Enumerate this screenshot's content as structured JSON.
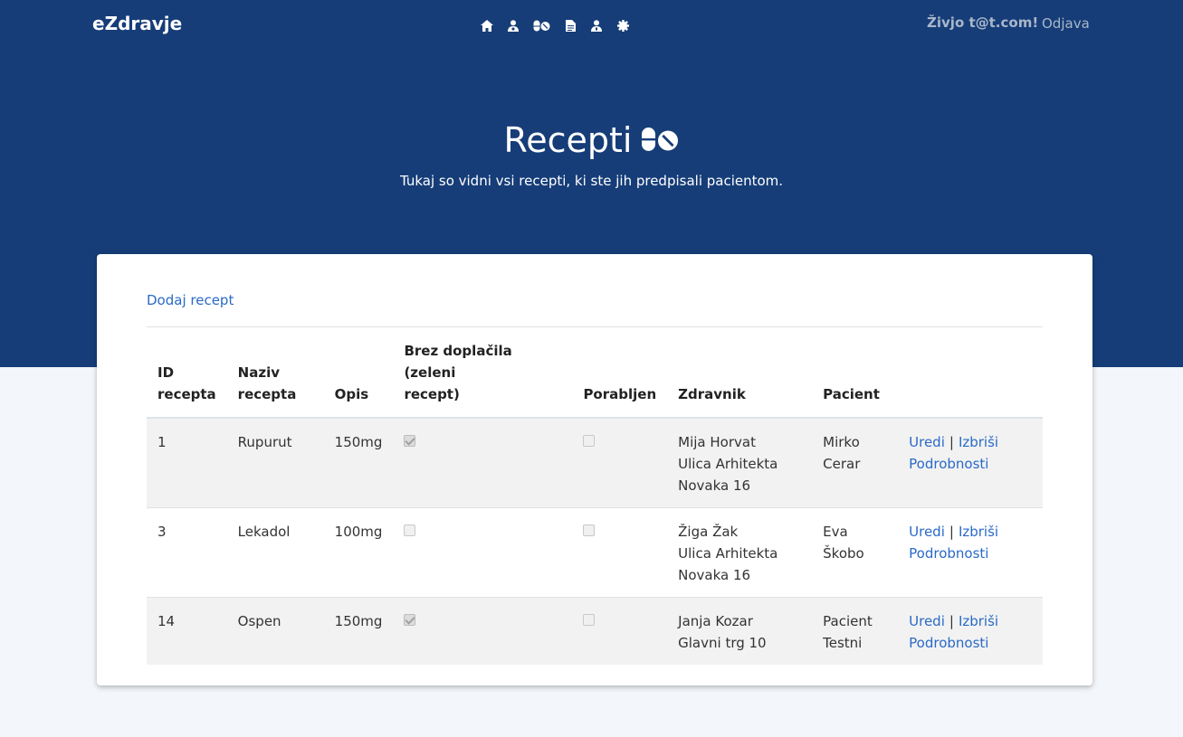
{
  "nav": {
    "brand": "eZdravje",
    "icons": [
      "home-icon",
      "user-doctor-icon",
      "pills-icon",
      "document-icon",
      "user-icon",
      "cog-icon"
    ],
    "greeting": "Živjo t@t.com!",
    "logout": "Odjava"
  },
  "hero": {
    "title": "Recepti",
    "title_icon": "pills-icon",
    "subtitle": "Tukaj so vidni vsi recepti, ki ste jih predpisali pacientom."
  },
  "colors": {
    "hero_bg": "#163d78",
    "link": "#2a6ac7",
    "page_bg": "#f3f6fa"
  },
  "table": {
    "add_link": "Dodaj recept",
    "headers": {
      "id_line1": "ID",
      "id_line2": "recepta",
      "name_line1": "Naziv",
      "name_line2": "recepta",
      "desc": "Opis",
      "free_line1": "Brez doplačila (zeleni",
      "free_line2": "recept)",
      "used": "Porabljen",
      "doctor": "Zdravnik",
      "patient": "Pacient"
    },
    "rows": [
      {
        "id": "1",
        "name": "Rupurut",
        "desc": "150mg",
        "free": true,
        "used": false,
        "doctor_name": "Mija Horvat",
        "doctor_addr1": "Ulica Arhitekta",
        "doctor_addr2": "Novaka 16",
        "patient1": "Mirko",
        "patient2": "Cerar",
        "edit": "Uredi",
        "delete": "Izbriši",
        "details": "Podrobnosti"
      },
      {
        "id": "3",
        "name": "Lekadol",
        "desc": "100mg",
        "free": false,
        "used": false,
        "doctor_name": "Žiga Žak",
        "doctor_addr1": "Ulica Arhitekta",
        "doctor_addr2": "Novaka 16",
        "patient1": "Eva",
        "patient2": "Škobo",
        "edit": "Uredi",
        "delete": "Izbriši",
        "details": "Podrobnosti"
      },
      {
        "id": "14",
        "name": "Ospen",
        "desc": "150mg",
        "free": true,
        "used": false,
        "doctor_name": "Janja Kozar",
        "doctor_addr1": "Glavni trg 10",
        "doctor_addr2": "",
        "patient1": "Pacient",
        "patient2": "Testni",
        "edit": "Uredi",
        "delete": "Izbriši",
        "details": "Podrobnosti"
      }
    ]
  }
}
